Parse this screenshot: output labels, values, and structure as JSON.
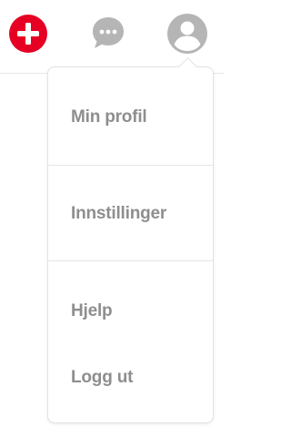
{
  "header": {
    "icons": {
      "add": "plus-circle-icon",
      "messages": "chat-bubble-icon",
      "profile": "user-avatar-icon"
    },
    "colors": {
      "add_button": "#e60023",
      "icon_gray": "#b5b5b5",
      "menu_text": "#8e8e8e"
    }
  },
  "menu": {
    "items": [
      {
        "label": "Min profil"
      },
      {
        "label": "Innstillinger"
      },
      {
        "label": "Hjelp"
      },
      {
        "label": "Logg ut"
      }
    ]
  }
}
